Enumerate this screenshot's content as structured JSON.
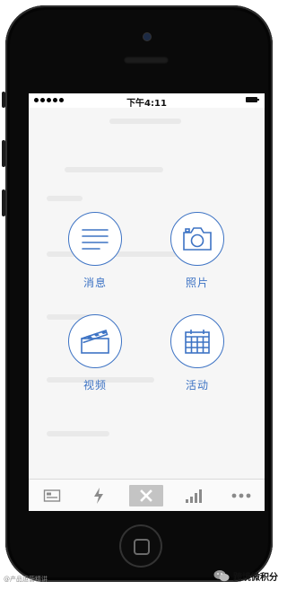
{
  "status_bar": {
    "time": "下午4:11"
  },
  "menu": {
    "items": [
      {
        "label": "消息",
        "icon": "list-icon"
      },
      {
        "label": "照片",
        "icon": "camera-icon"
      },
      {
        "label": "视频",
        "icon": "clapperboard-icon"
      },
      {
        "label": "活动",
        "icon": "calendar-icon"
      }
    ]
  },
  "tab_bar": {
    "tabs": [
      {
        "icon": "card-icon"
      },
      {
        "icon": "lightning-icon"
      },
      {
        "icon": "close-icon"
      },
      {
        "icon": "signal-bars-icon"
      },
      {
        "icon": "more-icon"
      }
    ]
  },
  "watermark": {
    "left_text": "@产品运营精讲",
    "brand_text": "跨境微积分"
  },
  "colors": {
    "accent": "#3d73c4",
    "close_bg": "#c4c4c4"
  }
}
